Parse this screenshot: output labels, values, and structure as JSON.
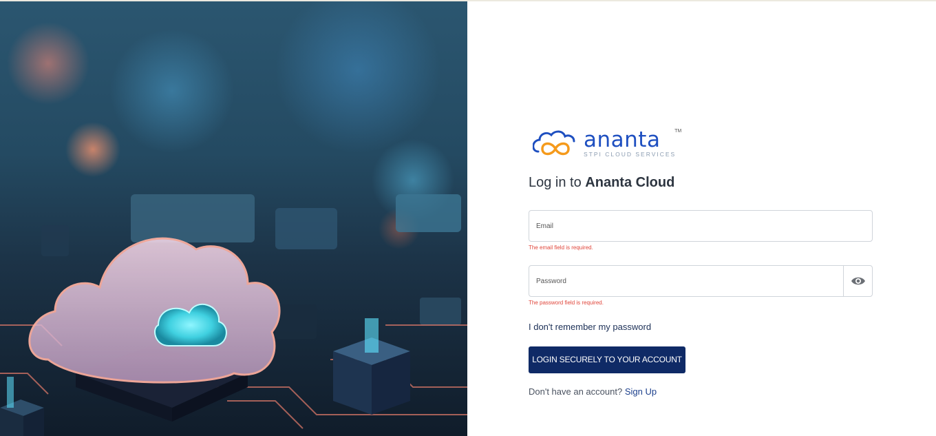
{
  "brand": {
    "logo_word": "ananta",
    "logo_tm": "TM",
    "logo_tagline": "STPI CLOUD SERVICES",
    "logo_colors": {
      "primary": "#1e4fc0",
      "accent": "#f59a1b"
    }
  },
  "login": {
    "title_prefix": "Log in to ",
    "title_brand": "Ananta Cloud",
    "email": {
      "placeholder": "Email",
      "value": "",
      "error": "The email field is required."
    },
    "password": {
      "placeholder": "Password",
      "value": "",
      "error": "The password field is required.",
      "toggle_icon": "eye-icon"
    },
    "forgot_link": "I don't remember my password",
    "submit_label": "LOGIN SECURELY TO YOUR ACCOUNT",
    "signup_prompt": "Don't have an account? ",
    "signup_link": "Sign Up"
  },
  "colors": {
    "button_bg": "#0f2a66",
    "error_text": "#e0453a",
    "link_text": "#1b2f56"
  }
}
